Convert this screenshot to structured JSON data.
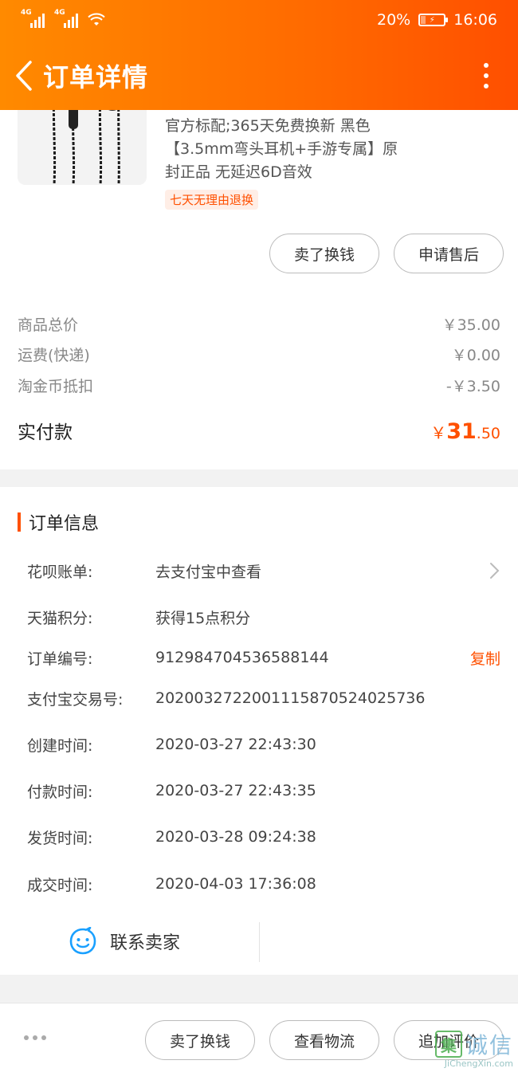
{
  "status_bar": {
    "network_1": "4G",
    "network_2": "4G",
    "battery_percent": "20%",
    "time": "16:06"
  },
  "nav": {
    "title": "订单详情"
  },
  "product": {
    "title_lines": [
      "官方标配;365天免费换新 黑色",
      "【3.5mm弯头耳机+手游专属】原",
      "封正品 无延迟6D音效"
    ],
    "return_badge": "七天无理由退换",
    "actions": {
      "sell": "卖了换钱",
      "after_sale": "申请售后"
    }
  },
  "pricing": {
    "rows": [
      {
        "label": "商品总价",
        "value": "￥35.00"
      },
      {
        "label": "运费(快递)",
        "value": "￥0.00"
      },
      {
        "label": "淘金币抵扣",
        "value": "-￥3.50"
      }
    ],
    "paid_label": "实付款",
    "paid_currency": "￥",
    "paid_int": "31",
    "paid_dec": ".50",
    "accent_color": "#ff5000"
  },
  "order_info": {
    "section_title": "订单信息",
    "rows": [
      {
        "label": "花呗账单:",
        "value": "去支付宝中查看"
      },
      {
        "label": "天猫积分:",
        "value": "获得15点积分"
      },
      {
        "label": "订单编号:",
        "value": "912984704536588144",
        "action": "复制"
      },
      {
        "label": "支付宝交易号:",
        "value": "2020032722001115870524025736"
      },
      {
        "label": "创建时间:",
        "value": "2020-03-27 22:43:30"
      },
      {
        "label": "付款时间:",
        "value": "2020-03-27 22:43:35"
      },
      {
        "label": "发货时间:",
        "value": "2020-03-28 09:24:38"
      },
      {
        "label": "成交时间:",
        "value": "2020-04-03 17:36:08"
      }
    ],
    "contact_seller": "联系卖家"
  },
  "bottom_bar": {
    "sell": "卖了换钱",
    "logistics": "查看物流",
    "review": "追加评价"
  },
  "watermark": {
    "main_char": "集",
    "text": "诚信",
    "url": "JiChengXin.com"
  }
}
